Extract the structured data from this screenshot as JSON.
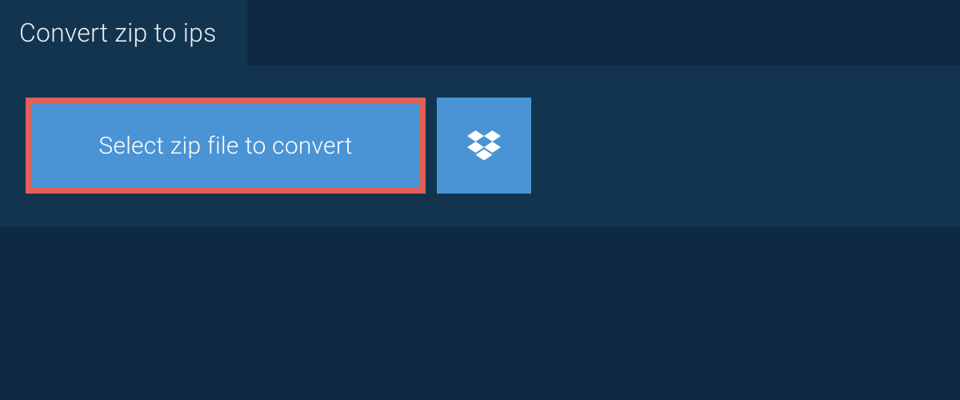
{
  "tab": {
    "title": "Convert zip to ips"
  },
  "buttons": {
    "select_file_label": "Select zip file to convert"
  },
  "colors": {
    "background": "#0e2a42",
    "panel": "#12344f",
    "button": "#4a94d6",
    "highlight_border": "#e06055",
    "text_light": "#ffffff"
  }
}
